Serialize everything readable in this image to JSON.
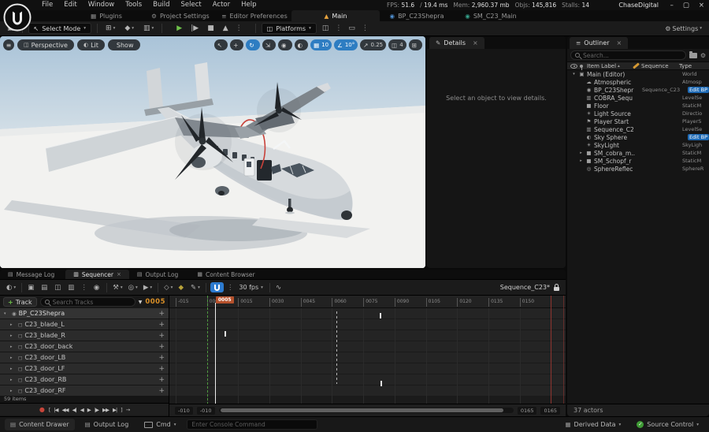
{
  "titlebar": {
    "menus": [
      "File",
      "Edit",
      "Window",
      "Tools",
      "Build",
      "Select",
      "Actor",
      "Help"
    ],
    "stats": [
      {
        "label": "FPS:",
        "value": "51.6"
      },
      {
        "label": "/",
        "value": "19.4 ms"
      },
      {
        "label": "Mem:",
        "value": "2,960.37 mb"
      },
      {
        "label": "Objs:",
        "value": "145,816"
      },
      {
        "label": "Stalls:",
        "value": "14"
      }
    ],
    "app_name": "ChaseDigital",
    "window_controls": [
      {
        "name": "minimize-button",
        "glyph": "–"
      },
      {
        "name": "maximize-button",
        "glyph": "▢"
      },
      {
        "name": "close-button",
        "glyph": "×"
      }
    ],
    "tabs": [
      {
        "label": "Plugins",
        "icon": "▦",
        "istyle": "color:#909090",
        "cls": ""
      },
      {
        "label": "Project Settings",
        "icon": "⚙",
        "istyle": "color:#909090",
        "cls": ""
      },
      {
        "label": "Editor Preferences",
        "icon": "≡",
        "istyle": "color:#909090",
        "cls": ""
      },
      {
        "label": "Main",
        "icon": "▲",
        "istyle": "color:#e8a33d",
        "cls": "active"
      },
      {
        "label": "BP_C23Shepra",
        "icon": "◉",
        "istyle": "color:#4f8fd0",
        "cls": ""
      },
      {
        "label": "SM_C23_Main",
        "icon": "◉",
        "istyle": "color:#35a08a",
        "cls": ""
      }
    ]
  },
  "toolbar": {
    "save_icon": "▣",
    "select_mode": {
      "icon": "↖",
      "label": "Select Mode",
      "caret": "▾"
    },
    "create_icons": [
      {
        "name": "add-actor-button",
        "glyph": "⊞",
        "caret": "▾",
        "cls": ""
      },
      {
        "name": "blueprints-button",
        "glyph": "◆",
        "caret": "▾",
        "cls": ""
      },
      {
        "name": "cinematics-button",
        "glyph": "▥",
        "caret": "▾",
        "cls": ""
      }
    ],
    "play_icons": [
      {
        "name": "play-button",
        "glyph": "▶",
        "cls": "green"
      },
      {
        "name": "frame-skip-button",
        "glyph": "|▶",
        "cls": ""
      },
      {
        "name": "stop-button",
        "glyph": "■",
        "cls": ""
      },
      {
        "name": "eject-button",
        "glyph": "▲",
        "cls": ""
      },
      {
        "name": "play-options-button",
        "glyph": "⋮",
        "cls": "dots"
      }
    ],
    "platforms": {
      "icon": "◫",
      "label": "Platforms",
      "caret": "▾"
    },
    "right_icons": [
      {
        "name": "derived-data-button",
        "glyph": "◫",
        "cls": ""
      },
      {
        "name": "more-button",
        "glyph": "⋮",
        "cls": "dots"
      },
      {
        "name": "layout-button",
        "glyph": "▭",
        "cls": ""
      },
      {
        "name": "more-button",
        "glyph": "⋮",
        "cls": "dots"
      }
    ],
    "settings": {
      "icon": "⚙",
      "label": "Settings",
      "caret": "▾"
    }
  },
  "viewport": {
    "menu_icon": "≡",
    "pills": [
      {
        "name": "perspective-menu",
        "icon": "◫",
        "label": "Perspective"
      },
      {
        "name": "view-mode-menu",
        "icon": "◐",
        "label": "Lit"
      },
      {
        "name": "show-menu",
        "icon": "",
        "label": "Show"
      }
    ],
    "chips": [
      {
        "name": "select-tool",
        "glyph": "↖",
        "value": "",
        "cls": ""
      },
      {
        "name": "move-tool",
        "glyph": "+",
        "value": "",
        "cls": ""
      },
      {
        "name": "rotate-tool",
        "glyph": "↻",
        "value": "",
        "cls": "active"
      },
      {
        "name": "scale-tool",
        "glyph": "⇲",
        "value": "",
        "cls": ""
      },
      {
        "name": "surface-snap-toggle",
        "glyph": "◉",
        "value": "",
        "cls": ""
      },
      {
        "name": "world-local-toggle",
        "glyph": "◐",
        "value": "",
        "cls": ""
      },
      {
        "name": "grid-snap-toggle",
        "glyph": "▦",
        "value": "10",
        "cls": "active"
      },
      {
        "name": "rotation-snap-toggle",
        "glyph": "∠",
        "value": "10°",
        "cls": "active"
      },
      {
        "name": "scale-snap-toggle",
        "glyph": "↗",
        "value": "0.25",
        "cls": ""
      },
      {
        "name": "camera-speed-button",
        "glyph": "◫",
        "value": "4",
        "cls": ""
      },
      {
        "name": "maximize-viewport-button",
        "glyph": "⊞",
        "value": "",
        "cls": ""
      }
    ]
  },
  "details": {
    "tab": "Details",
    "tab_icon": "✎",
    "close": "×",
    "empty_text": "Select an object to view details."
  },
  "outliner": {
    "tab": "Outliner",
    "tab_icon": "≡",
    "close": "×",
    "search_placeholder": "Search...",
    "gear_icon": "⚙",
    "columns": {
      "item": "Item Label",
      "sort": "▴",
      "sequence": "Sequence",
      "type": "Type"
    },
    "rows": [
      {
        "arrow": "▾",
        "icon": "▣",
        "label": "Main (Editor)",
        "seq": "",
        "type": "World",
        "cls": "root",
        "tcls": ""
      },
      {
        "arrow": "",
        "icon": "☁",
        "label": "Atmospheric",
        "seq": "",
        "type": "Atmosp",
        "cls": "",
        "tcls": ""
      },
      {
        "arrow": "",
        "icon": "◉",
        "label": "BP_C23Shepr",
        "seq": "Sequence_C23",
        "type": "Edit BP",
        "cls": "",
        "tcls": "link"
      },
      {
        "arrow": "",
        "icon": "▥",
        "label": "COBRA_Sequ",
        "seq": "",
        "type": "LevelSe",
        "cls": "",
        "tcls": ""
      },
      {
        "arrow": "",
        "icon": "■",
        "label": "Floor",
        "seq": "",
        "type": "StaticM",
        "cls": "",
        "tcls": ""
      },
      {
        "arrow": "",
        "icon": "☀",
        "label": "Light Source",
        "seq": "",
        "type": "Directio",
        "cls": "",
        "tcls": ""
      },
      {
        "arrow": "",
        "icon": "⚑",
        "label": "Player Start",
        "seq": "",
        "type": "PlayerS",
        "cls": "",
        "tcls": ""
      },
      {
        "arrow": "",
        "icon": "▥",
        "label": "Sequence_C2",
        "seq": "",
        "type": "LevelSe",
        "cls": "",
        "tcls": ""
      },
      {
        "arrow": "",
        "icon": "◐",
        "label": "Sky Sphere",
        "seq": "",
        "type": "Edit BP",
        "cls": "",
        "tcls": "link"
      },
      {
        "arrow": "",
        "icon": "☀",
        "label": "SkyLight",
        "seq": "",
        "type": "SkyLigh",
        "cls": "",
        "tcls": ""
      },
      {
        "arrow": "▸",
        "icon": "■",
        "label": "SM_cobra_m..",
        "seq": "",
        "type": "StaticM",
        "cls": "",
        "tcls": ""
      },
      {
        "arrow": "▸",
        "icon": "■",
        "label": "SM_Schopf_r",
        "seq": "",
        "type": "StaticM",
        "cls": "",
        "tcls": ""
      },
      {
        "arrow": "",
        "icon": "◎",
        "label": "SphereReflec",
        "seq": "",
        "type": "SphereR",
        "cls": "",
        "tcls": ""
      }
    ],
    "footer": "37 actors"
  },
  "dock": {
    "tabs": [
      {
        "label": "Message Log",
        "icon": "▤",
        "cls": "",
        "close": ""
      },
      {
        "label": "Sequencer",
        "icon": "▥",
        "cls": "active",
        "close": "×"
      },
      {
        "label": "Output Log",
        "icon": "▤",
        "cls": "",
        "close": ""
      },
      {
        "label": "Content Browser",
        "icon": "▦",
        "cls": "",
        "close": ""
      }
    ]
  },
  "sequencer": {
    "toolbar_icons": [
      {
        "name": "world-options-button",
        "glyph": "◐",
        "caret": "▾",
        "cls": ""
      },
      {
        "name": "separator",
        "glyph": "",
        "caret": "",
        "cls": "sep"
      },
      {
        "name": "save-button",
        "glyph": "▣",
        "caret": "",
        "cls": ""
      },
      {
        "name": "browse-sequence-button",
        "glyph": "▤",
        "caret": "",
        "cls": ""
      },
      {
        "name": "create-camera-button",
        "glyph": "◫",
        "caret": "",
        "cls": ""
      },
      {
        "name": "render-movie-button",
        "glyph": "▥",
        "caret": "",
        "cls": ""
      },
      {
        "name": "more-button",
        "glyph": "⋮",
        "caret": "",
        "cls": "dots"
      },
      {
        "name": "bind-actors-button",
        "glyph": "◉",
        "caret": "",
        "cls": ""
      },
      {
        "name": "separator",
        "glyph": "",
        "caret": "",
        "cls": "sep"
      },
      {
        "name": "sequencer-settings-button",
        "glyph": "⚒",
        "caret": "▾",
        "cls": ""
      },
      {
        "name": "view-options-button",
        "glyph": "◎",
        "caret": "▾",
        "cls": ""
      },
      {
        "name": "playback-options-button",
        "glyph": "▶",
        "caret": "▾",
        "cls": ""
      },
      {
        "name": "separator",
        "glyph": "",
        "caret": "",
        "cls": "sep"
      },
      {
        "name": "keyframe-options-button",
        "glyph": "◇",
        "caret": "▾",
        "cls": ""
      },
      {
        "name": "auto-key-button",
        "glyph": "◆",
        "caret": "",
        "cls": "gold"
      },
      {
        "name": "curve-options-button",
        "glyph": "✎",
        "caret": "▾",
        "cls": ""
      },
      {
        "name": "separator",
        "glyph": "",
        "caret": "",
        "cls": "sep"
      }
    ],
    "magnet_dots": "⋮",
    "fps": "30 fps",
    "fps_caret": "▾",
    "curve_editor_icon": "∿",
    "name": "Sequence_C23*",
    "add_track": "Track",
    "plus": "+",
    "search_placeholder": "Search Tracks",
    "filter_icon": "▼",
    "current_frame": "0005",
    "tracks": [
      {
        "arrow": "▾",
        "icon": "◉",
        "label": "BP_C23Shepra",
        "cls": "parent",
        "plus": "+"
      },
      {
        "arrow": "▸",
        "icon": "◻",
        "label": "C23_blade_L",
        "cls": "",
        "plus": "+"
      },
      {
        "arrow": "▸",
        "icon": "◻",
        "label": "C23_blade_R",
        "cls": "",
        "plus": "+"
      },
      {
        "arrow": "▸",
        "icon": "◻",
        "label": "C23_door_back",
        "cls": "",
        "plus": "+"
      },
      {
        "arrow": "▸",
        "icon": "◻",
        "label": "C23_door_LB",
        "cls": "",
        "plus": "+"
      },
      {
        "arrow": "▸",
        "icon": "◻",
        "label": "C23_door_LF",
        "cls": "",
        "plus": "+"
      },
      {
        "arrow": "▸",
        "icon": "◻",
        "label": "C23_door_RB",
        "cls": "",
        "plus": "+"
      },
      {
        "arrow": "▸",
        "icon": "◻",
        "label": "C23_door_RF",
        "cls": "",
        "plus": "+"
      }
    ],
    "items_count": "59 items",
    "transport": [
      {
        "name": "record-button",
        "glyph": "●",
        "cls": "rec"
      },
      {
        "name": "set-start-button",
        "glyph": "[",
        "cls": ""
      },
      {
        "name": "go-to-front-button",
        "glyph": "|◀",
        "cls": ""
      },
      {
        "name": "previous-key-button",
        "glyph": "◀◀",
        "cls": ""
      },
      {
        "name": "step-back-button",
        "glyph": "◀|",
        "cls": ""
      },
      {
        "name": "play-reverse-button",
        "glyph": "◀",
        "cls": ""
      },
      {
        "name": "play-button",
        "glyph": "▶",
        "cls": ""
      },
      {
        "name": "step-forward-button",
        "glyph": "|▶",
        "cls": ""
      },
      {
        "name": "next-key-button",
        "glyph": "▶▶",
        "cls": ""
      },
      {
        "name": "go-to-end-button",
        "glyph": "▶|",
        "cls": ""
      },
      {
        "name": "set-end-button",
        "glyph": "]",
        "cls": ""
      },
      {
        "name": "loop-button",
        "glyph": "→",
        "cls": ""
      }
    ],
    "timeline": {
      "ticks": [
        {
          "label": "-015",
          "style": "left:1.58%"
        },
        {
          "label": "0000",
          "style": "left:9.47%"
        },
        {
          "label": "0015",
          "style": "left:17.37%"
        },
        {
          "label": "0030",
          "style": "left:25.26%"
        },
        {
          "label": "0045",
          "style": "left:33.16%"
        },
        {
          "label": "0060",
          "style": "left:41.05%"
        },
        {
          "label": "0075",
          "style": "left:48.95%"
        },
        {
          "label": "0090",
          "style": "left:56.84%"
        },
        {
          "label": "0105",
          "style": "left:64.74%"
        },
        {
          "label": "0120",
          "style": "left:72.63%"
        },
        {
          "label": "0135",
          "style": "left:80.53%"
        },
        {
          "label": "0150",
          "style": "left:88.42%"
        }
      ],
      "playhead": {
        "label": "0005",
        "line_style": "left:11.5%",
        "chip_style": "left:11.5%"
      },
      "start_style": "left:9.47%",
      "dash_style": "left:42.1%",
      "end_style": "left:96.3%",
      "edge_style": "left:99.4%",
      "keys": [
        {
          "style": "left:13.9%;top:29px"
        },
        {
          "style": "left:53.1%;top:6px"
        },
        {
          "style": "left:53.3%;top:92px"
        }
      ],
      "range_start": "-010",
      "range_start2": "-010",
      "range_end": "0165",
      "range_end2": "0165"
    }
  },
  "statusbar": {
    "content_drawer": "Content Drawer",
    "content_drawer_icon": "▤",
    "output_log": "Output Log",
    "output_log_icon": "▤",
    "cmd": "Cmd",
    "cmd_caret": "▾",
    "console_placeholder": "Enter Console Command",
    "derived_data": "Derived Data",
    "derived_data_icon": "▦",
    "source_control": "Source Control",
    "check": "✓",
    "caret": "▾"
  },
  "colors": {
    "accent_blue": "#2e7dc2",
    "accent_orange": "#d98f27",
    "play_green": "#6fc24a",
    "link_blue": "#1d69b4",
    "playhead_red": "#b5512c",
    "viewport_sky": "#a9c3d8",
    "viewport_floor": "#f2f2f0"
  }
}
